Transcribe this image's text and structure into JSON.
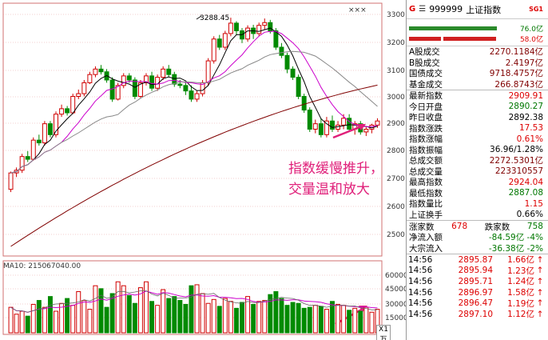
{
  "chart_data": [
    {
      "type": "candlestick",
      "title": "",
      "peak_label": "3288.45",
      "ylim": [
        2700,
        3320
      ],
      "yticks": [
        "3300",
        "3200",
        "3100",
        "3000",
        "2900",
        "2800",
        "2700",
        "2600",
        "2500"
      ],
      "candles": [
        [
          2660,
          2720,
          2650,
          2725
        ],
        [
          2720,
          2730,
          2705,
          2740
        ],
        [
          2730,
          2780,
          2720,
          2790
        ],
        [
          2780,
          2770,
          2760,
          2800
        ],
        [
          2770,
          2840,
          2765,
          2850
        ],
        [
          2840,
          2830,
          2820,
          2860
        ],
        [
          2830,
          2900,
          2820,
          2910
        ],
        [
          2900,
          2860,
          2850,
          2910
        ],
        [
          2860,
          2935,
          2850,
          2945
        ],
        [
          2935,
          2955,
          2925,
          2970
        ],
        [
          2955,
          2940,
          2930,
          2965
        ],
        [
          2940,
          3000,
          2935,
          3010
        ],
        [
          3000,
          3010,
          2990,
          3025
        ],
        [
          3010,
          3050,
          3000,
          3060
        ],
        [
          3050,
          3080,
          3045,
          3090
        ],
        [
          3080,
          3100,
          3070,
          3110
        ],
        [
          3100,
          3090,
          3080,
          3115
        ],
        [
          3090,
          3060,
          3050,
          3100
        ],
        [
          3060,
          2990,
          2980,
          3070
        ],
        [
          2990,
          3040,
          2985,
          3050
        ],
        [
          3040,
          3075,
          3030,
          3085
        ],
        [
          3075,
          3060,
          3050,
          3085
        ],
        [
          3060,
          3000,
          2990,
          3070
        ],
        [
          3000,
          3050,
          2995,
          3060
        ],
        [
          3050,
          3075,
          3040,
          3085
        ],
        [
          3075,
          3030,
          3020,
          3090
        ],
        [
          3030,
          3070,
          3020,
          3080
        ],
        [
          3070,
          3100,
          3060,
          3110
        ],
        [
          3100,
          3080,
          3070,
          3115
        ],
        [
          3080,
          3045,
          3035,
          3090
        ],
        [
          3045,
          3040,
          3030,
          3060
        ],
        [
          3040,
          3020,
          3005,
          3050
        ],
        [
          3020,
          2990,
          2980,
          3040
        ],
        [
          2990,
          3010,
          2980,
          3020
        ],
        [
          3010,
          3050,
          3000,
          3060
        ],
        [
          3050,
          3130,
          3040,
          3140
        ],
        [
          3130,
          3210,
          3120,
          3220
        ],
        [
          3210,
          3180,
          3170,
          3225
        ],
        [
          3180,
          3230,
          3170,
          3240
        ],
        [
          3230,
          3268,
          3220,
          3288
        ],
        [
          3268,
          3240,
          3225,
          3275
        ],
        [
          3240,
          3210,
          3195,
          3250
        ],
        [
          3210,
          3250,
          3200,
          3260
        ],
        [
          3250,
          3230,
          3210,
          3262
        ],
        [
          3230,
          3260,
          3220,
          3270
        ],
        [
          3260,
          3270,
          3245,
          3285
        ],
        [
          3270,
          3240,
          3230,
          3280
        ],
        [
          3240,
          3180,
          3170,
          3250
        ],
        [
          3180,
          3150,
          3140,
          3195
        ],
        [
          3150,
          3100,
          3085,
          3160
        ],
        [
          3100,
          3070,
          3060,
          3110
        ],
        [
          3070,
          3000,
          2990,
          3080
        ],
        [
          3000,
          2950,
          2940,
          3010
        ],
        [
          2950,
          2880,
          2870,
          2960
        ],
        [
          2880,
          2900,
          2865,
          2915
        ],
        [
          2900,
          2860,
          2850,
          2920
        ],
        [
          2860,
          2910,
          2850,
          2925
        ],
        [
          2910,
          2880,
          2870,
          2930
        ],
        [
          2880,
          2895,
          2870,
          2910
        ],
        [
          2895,
          2920,
          2880,
          2935
        ],
        [
          2920,
          2880,
          2870,
          2935
        ],
        [
          2880,
          2900,
          2860,
          2910
        ],
        [
          2900,
          2870,
          2860,
          2910
        ],
        [
          2870,
          2880,
          2855,
          2890
        ],
        [
          2880,
          2895,
          2865,
          2900
        ],
        [
          2895,
          2910,
          2885,
          2920
        ]
      ],
      "ma_series": [
        {
          "name": "MA5",
          "color": "#000000"
        },
        {
          "name": "MA10",
          "color": "#cc00cc"
        },
        {
          "name": "MA20",
          "color": "#888888"
        },
        {
          "name": "MA60",
          "color": "#800000"
        }
      ]
    },
    {
      "type": "bar",
      "title": "",
      "label": "MA10: 215067040.00",
      "ylim": [
        0,
        62000
      ],
      "yticks": [
        "60000",
        "45000",
        "30000",
        "15000"
      ],
      "x_unit": "X1万",
      "volumes": [
        26000,
        19000,
        22000,
        17000,
        29000,
        33000,
        26000,
        37000,
        22000,
        30000,
        35000,
        28000,
        42000,
        33000,
        24000,
        48000,
        45000,
        26000,
        40000,
        52000,
        48000,
        38000,
        30000,
        46000,
        52000,
        32000,
        28000,
        44000,
        35000,
        37000,
        33000,
        29000,
        48000,
        49000,
        40000,
        30000,
        34000,
        27000,
        35000,
        32000,
        25000,
        31000,
        37000,
        29000,
        32000,
        33000,
        39000,
        42000,
        35000,
        28000,
        31000,
        30000,
        25000,
        26000,
        28000,
        27000,
        24000,
        32000,
        29000,
        28000,
        23000,
        25000,
        22000,
        26000,
        21000,
        24000
      ],
      "up": [
        true,
        true,
        true,
        false,
        true,
        false,
        true,
        false,
        true,
        true,
        false,
        true,
        true,
        true,
        true,
        true,
        false,
        false,
        false,
        true,
        true,
        false,
        false,
        true,
        true,
        false,
        true,
        true,
        false,
        false,
        false,
        false,
        false,
        true,
        true,
        true,
        true,
        false,
        true,
        true,
        false,
        false,
        true,
        false,
        true,
        true,
        false,
        false,
        false,
        false,
        false,
        false,
        false,
        false,
        true,
        false,
        true,
        false,
        true,
        true,
        false,
        true,
        false,
        true,
        true,
        true
      ]
    }
  ],
  "topright_icons": "×××",
  "panel": {
    "g": "G",
    "menu": "☰",
    "code": "999999",
    "name": "上证指数",
    "tag": "SG1",
    "bar_top_value": "76.0亿",
    "bar_bottom_value": "58.0亿",
    "stats": [
      {
        "label": "A股成交",
        "value": "2270.1184亿",
        "cls": "dk"
      },
      {
        "label": "B股成交",
        "value": "2.4197亿",
        "cls": "dk"
      },
      {
        "label": "国债成交",
        "value": "9718.4757亿",
        "cls": "dk"
      },
      {
        "label": "基金成交",
        "value": "266.8743亿",
        "cls": "dk"
      }
    ],
    "quote": [
      {
        "label": "最新指数",
        "value": "2909.91",
        "cls": "red"
      },
      {
        "label": "今日开盘",
        "value": "2890.27",
        "cls": "grn"
      },
      {
        "label": "昨日收盘",
        "value": "2892.38",
        "cls": ""
      },
      {
        "label": "指数涨跌",
        "value": "17.53",
        "cls": "red"
      },
      {
        "label": "指数涨幅",
        "value": "0.61%",
        "cls": "red"
      },
      {
        "label": "指数振幅",
        "value": "36.96/1.28%",
        "cls": ""
      },
      {
        "label": "总成交额",
        "value": "2272.5301亿",
        "cls": "dk"
      },
      {
        "label": "总成交量",
        "value": "223310557",
        "cls": "dk"
      },
      {
        "label": "最高指数",
        "value": "2924.04",
        "cls": "red"
      },
      {
        "label": "最低指数",
        "value": "2887.08",
        "cls": "grn"
      },
      {
        "label": "指数量比",
        "value": "1.15",
        "cls": "red"
      },
      {
        "label": "上证换手",
        "value": "0.66%",
        "cls": ""
      }
    ],
    "up_label": "涨家数",
    "up_count": "678",
    "down_label": "跌家数",
    "down_count": "758",
    "flows": [
      {
        "label": "净流入额",
        "value": "-84.59亿",
        "pct": "-4%"
      },
      {
        "label": "大宗流入",
        "value": "-36.38亿",
        "pct": "-2%"
      }
    ],
    "ticks": [
      {
        "time": "14:56",
        "price": "2895.87",
        "vol": "1.66亿",
        "dir": "↑"
      },
      {
        "time": "14:56",
        "price": "2895.94",
        "vol": "1.23亿",
        "dir": "↑"
      },
      {
        "time": "14:56",
        "price": "2895.71",
        "vol": "1.24亿",
        "dir": "↑"
      },
      {
        "time": "14:56",
        "price": "2896.97",
        "vol": "1.58亿",
        "dir": "↑"
      },
      {
        "time": "14:56",
        "price": "2896.47",
        "vol": "1.19亿",
        "dir": "↑"
      },
      {
        "time": "14:56",
        "price": "2897.10",
        "vol": "1.12亿",
        "dir": "↑"
      }
    ]
  },
  "annotation": {
    "line1": "指数缓慢推升，",
    "line2": "交量温和放大"
  }
}
